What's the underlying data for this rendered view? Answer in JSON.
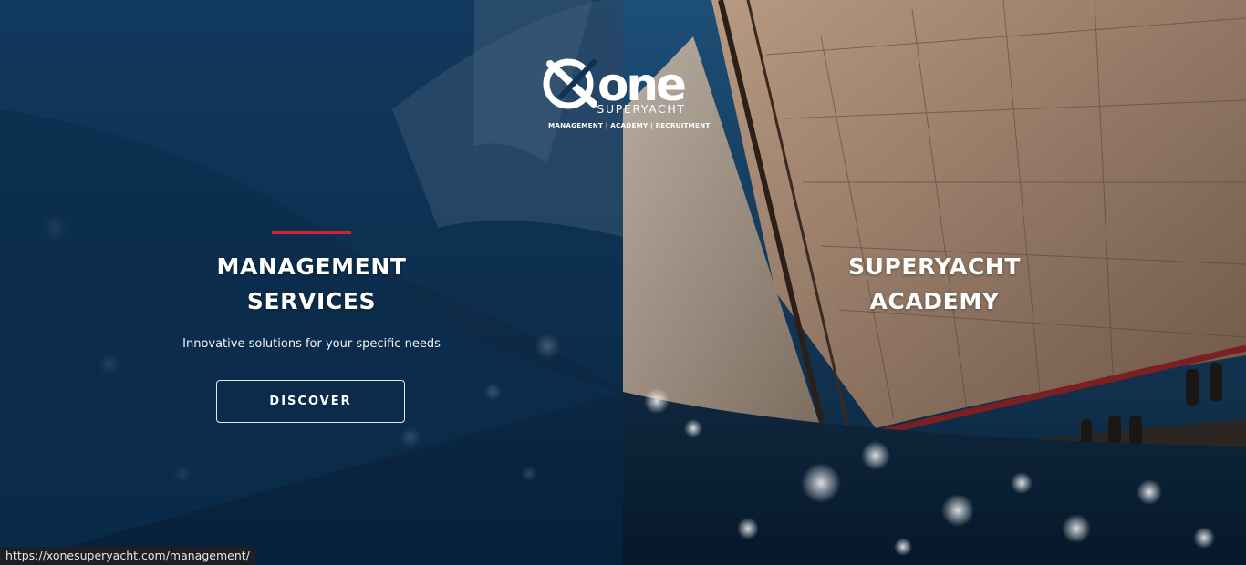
{
  "brand": {
    "logo_word": "one",
    "sub": "SUPERYACHT",
    "tagline": "MANAGEMENT | ACADEMY | RECRUITMENT"
  },
  "panels": [
    {
      "title_line1": "MANAGEMENT",
      "title_line2": "SERVICES",
      "subtitle": "Innovative solutions for your specific needs",
      "button_label": "DISCOVER"
    },
    {
      "title_line1": "SUPERYACHT",
      "title_line2": "ACADEMY"
    }
  ],
  "status_bar": {
    "url": "https://xonesuperyacht.com/management/"
  },
  "colors": {
    "accent": "#d0242f",
    "left_overlay": "#092848",
    "sea": "#0d2a44",
    "sail": "#b8a08a"
  }
}
